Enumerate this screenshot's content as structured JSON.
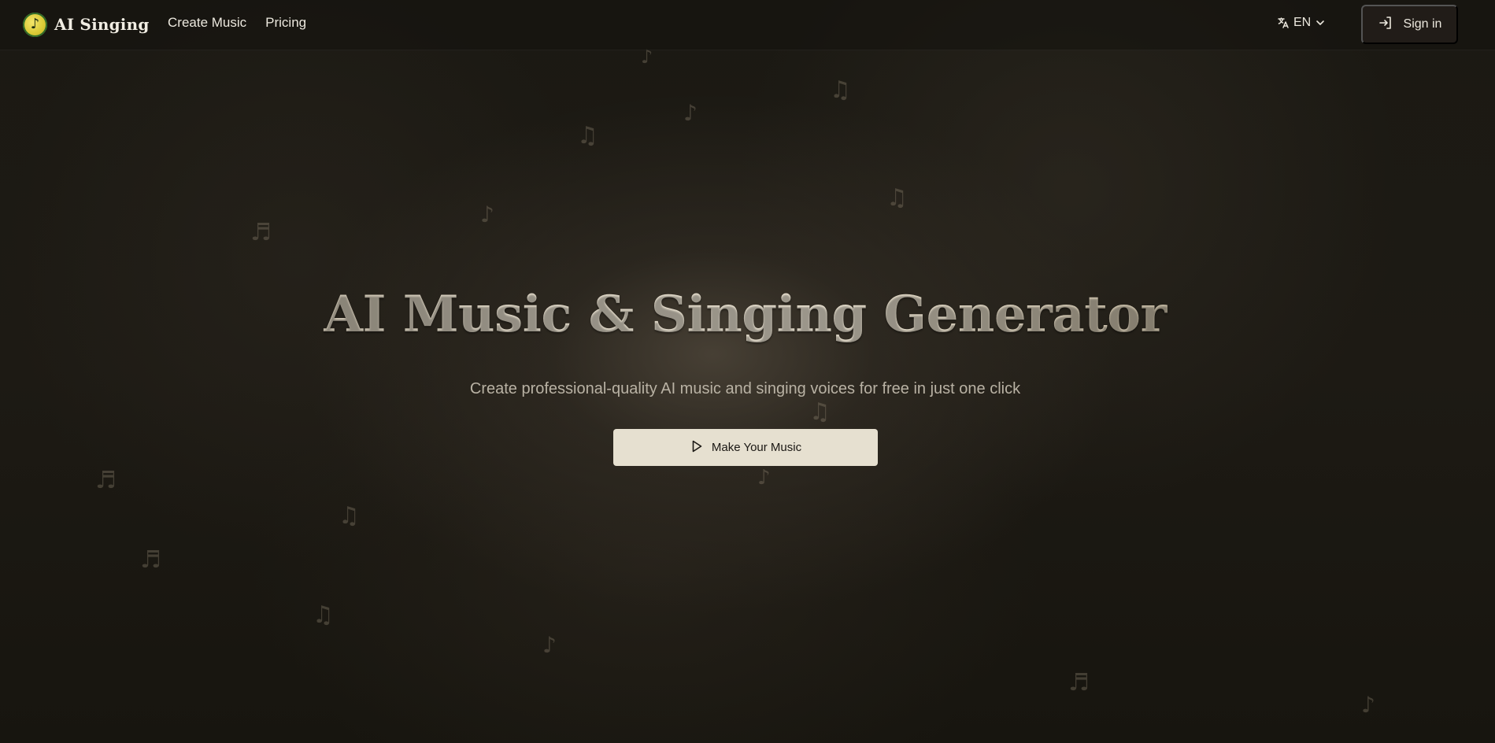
{
  "brand": {
    "name": "AI Singing",
    "logo_icon": "music-note-icon",
    "logo_color": "#e6d84a"
  },
  "nav": {
    "items": [
      {
        "label": "Create Music"
      },
      {
        "label": "Pricing"
      }
    ]
  },
  "language": {
    "icon": "translate-icon",
    "value": "EN",
    "chevron": "chevron-down-icon"
  },
  "auth": {
    "signin_label": "Sign in",
    "signin_icon": "sign-in-icon"
  },
  "hero": {
    "title": "AI Music & Singing Generator",
    "subtitle": "Create professional-quality AI music and singing voices for free in just one click",
    "cta_label": "Make Your Music",
    "cta_icon": "play-icon"
  },
  "theme": {
    "background": "#1b1913",
    "cta_background": "#e6e0d0",
    "text": "#ece8de"
  },
  "decorations": {
    "note_glyphs": [
      "♪",
      "♫",
      "♬"
    ]
  }
}
